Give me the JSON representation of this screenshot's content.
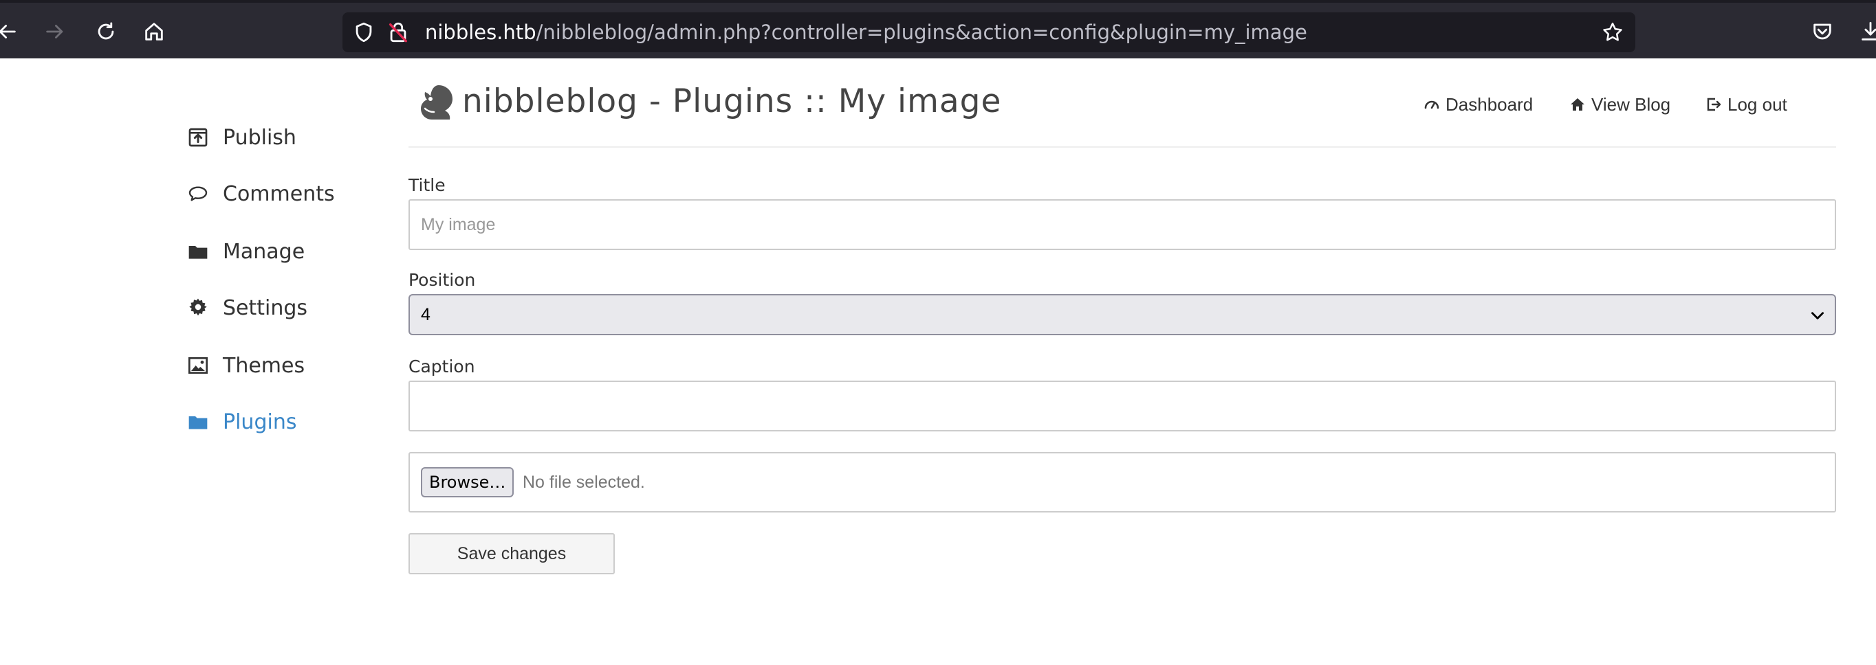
{
  "browser": {
    "url_host": "nibbles.htb",
    "url_path": "/nibbleblog/admin.php?controller=plugins&action=config&plugin=my_image",
    "icons": [
      "back-arrow-icon",
      "forward-arrow-icon",
      "reload-icon",
      "home-icon",
      "shield-icon",
      "insecure-lock-icon",
      "bookmark-star-icon",
      "pocket-icon",
      "download-icon"
    ]
  },
  "sidebar": {
    "items": [
      {
        "label": "Publish",
        "icon": "publish-icon"
      },
      {
        "label": "Comments",
        "icon": "comment-icon"
      },
      {
        "label": "Manage",
        "icon": "folder-icon"
      },
      {
        "label": "Settings",
        "icon": "gear-icon"
      },
      {
        "label": "Themes",
        "icon": "image-icon"
      },
      {
        "label": "Plugins",
        "icon": "folder-icon",
        "active": true
      }
    ]
  },
  "header": {
    "title": "nibbleblog - Plugins :: My image",
    "links": [
      {
        "label": "Dashboard",
        "icon": "dashboard-gauge-icon"
      },
      {
        "label": "View Blog",
        "icon": "home-icon"
      },
      {
        "label": "Log out",
        "icon": "logout-icon"
      }
    ]
  },
  "form": {
    "title_label": "Title",
    "title_placeholder": "My image",
    "title_value": "",
    "position_label": "Position",
    "position_value": "4",
    "caption_label": "Caption",
    "caption_value": "",
    "browse_label": "Browse…",
    "file_status": "No file selected.",
    "save_label": "Save changes"
  },
  "colors": {
    "chrome_bg": "#2b2a33",
    "url_bg": "#1c1b22",
    "active_link": "#3a87c8",
    "text": "#333333"
  }
}
